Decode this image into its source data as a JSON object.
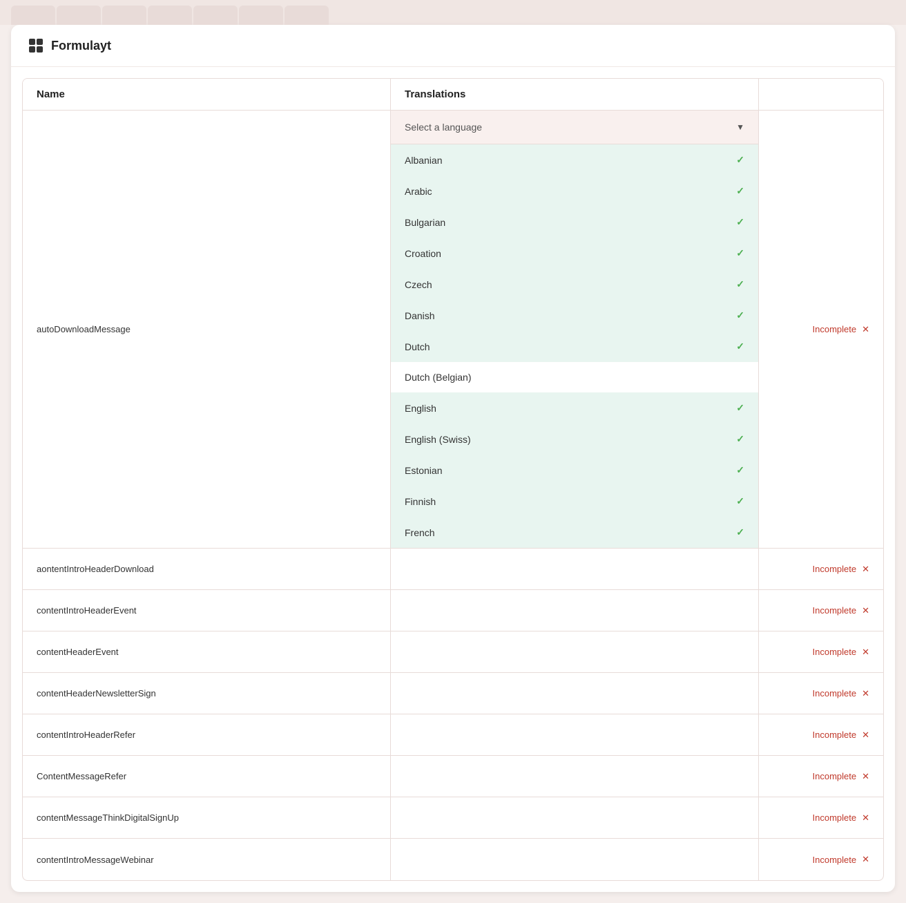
{
  "app": {
    "title": "Formulayt"
  },
  "table": {
    "columns": [
      "Name",
      "Translations",
      ""
    ],
    "rows": [
      {
        "name": "autoDownloadMessage",
        "status": "Incomplete"
      },
      {
        "name": "aontentIntroHeaderDownload",
        "status": "Incomplete"
      },
      {
        "name": "contentIntroHeaderEvent",
        "status": "Incomplete"
      },
      {
        "name": "contentHeaderEvent",
        "status": "Incomplete"
      },
      {
        "name": "contentHeaderNewsletterSign",
        "status": "Incomplete"
      },
      {
        "name": "contentIntroHeaderRefer",
        "status": "Incomplete"
      },
      {
        "name": "ContentMessageRefer",
        "status": "Incomplete"
      },
      {
        "name": "contentMessageThinkDigitalSignUp",
        "status": "Incomplete"
      },
      {
        "name": "contentIntroMessageWebinar",
        "status": "Incomplete"
      }
    ]
  },
  "dropdown": {
    "placeholder": "Select a language",
    "languages": [
      {
        "name": "Albanian",
        "complete": true
      },
      {
        "name": "Arabic",
        "complete": true
      },
      {
        "name": "Bulgarian",
        "complete": true
      },
      {
        "name": "Croation",
        "complete": true
      },
      {
        "name": "Czech",
        "complete": true
      },
      {
        "name": "Danish",
        "complete": true
      },
      {
        "name": "Dutch",
        "complete": true
      },
      {
        "name": "Dutch (Belgian)",
        "complete": false
      },
      {
        "name": "English",
        "complete": true
      },
      {
        "name": "English (Swiss)",
        "complete": true
      },
      {
        "name": "Estonian",
        "complete": true
      },
      {
        "name": "Finnish",
        "complete": true
      },
      {
        "name": "French",
        "complete": true
      }
    ]
  },
  "labels": {
    "incomplete": "Incomplete",
    "close": "✕",
    "check": "✓",
    "arrow_down": "▼"
  },
  "colors": {
    "accent_red": "#c0392b",
    "check_green": "#4caf50",
    "dropdown_bg": "#e8f5f0",
    "trigger_bg": "#f9f0ee"
  }
}
